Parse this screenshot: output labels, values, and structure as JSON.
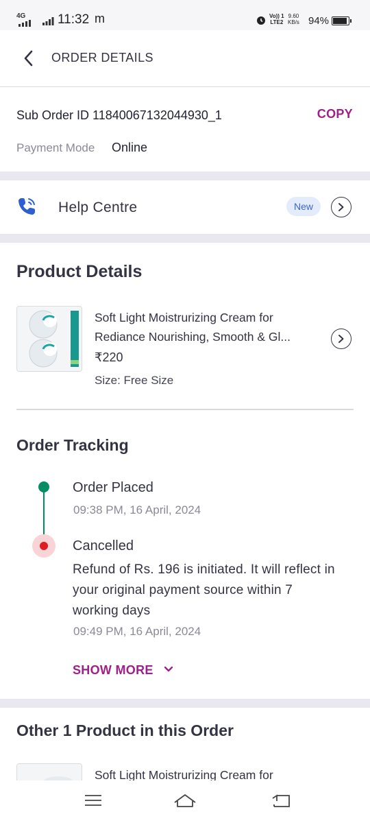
{
  "status_bar": {
    "network": "4G",
    "time": "11:32",
    "carrier_icon": "m",
    "volte": [
      "Vo)) 1",
      "LTE2"
    ],
    "speed": [
      "9.60",
      "KB/s"
    ],
    "battery": "94%",
    "battery_level": 0.94,
    "icons": [
      "signal-icon",
      "alarm-icon",
      "battery-icon"
    ]
  },
  "header": {
    "title": "ORDER DETAILS",
    "back_icon": "back-arrow-icon"
  },
  "suborder": {
    "label": "Sub Order ID 11840067132044930_1",
    "copy_label": "COPY",
    "payment_mode_label": "Payment Mode",
    "payment_mode_value": "Online"
  },
  "help": {
    "label": "Help Centre",
    "badge": "New",
    "icon": "phone-icon"
  },
  "product_details": {
    "title": "Product Details",
    "name_line1": "Soft  Light Moistrurizing Cream for",
    "name_line2": "Rediance Nourishing, Smooth & Gl...",
    "price": "₹220",
    "size": "Size: Free Size"
  },
  "tracking": {
    "title": "Order Tracking",
    "steps": [
      {
        "title": "Order Placed",
        "time": "09:38 PM, 16 April, 2024",
        "status_color": "#038d63"
      },
      {
        "title": "Cancelled",
        "description": "Refund of Rs. 196 is initiated. It will reflect in your original payment source within 7 working days",
        "time": "09:49 PM, 16 April, 2024",
        "status_color": "#e11b22"
      }
    ],
    "show_more": "SHOW MORE"
  },
  "other_products": {
    "title": "Other 1 Product in this Order",
    "name_line1": "Soft  Light Moistrurizing Cream for"
  },
  "colors": {
    "accent": "#9f2089",
    "success": "#038d63",
    "error": "#e11b22",
    "badge_bg": "#e4ecfb",
    "badge_text": "#3a67c9"
  }
}
